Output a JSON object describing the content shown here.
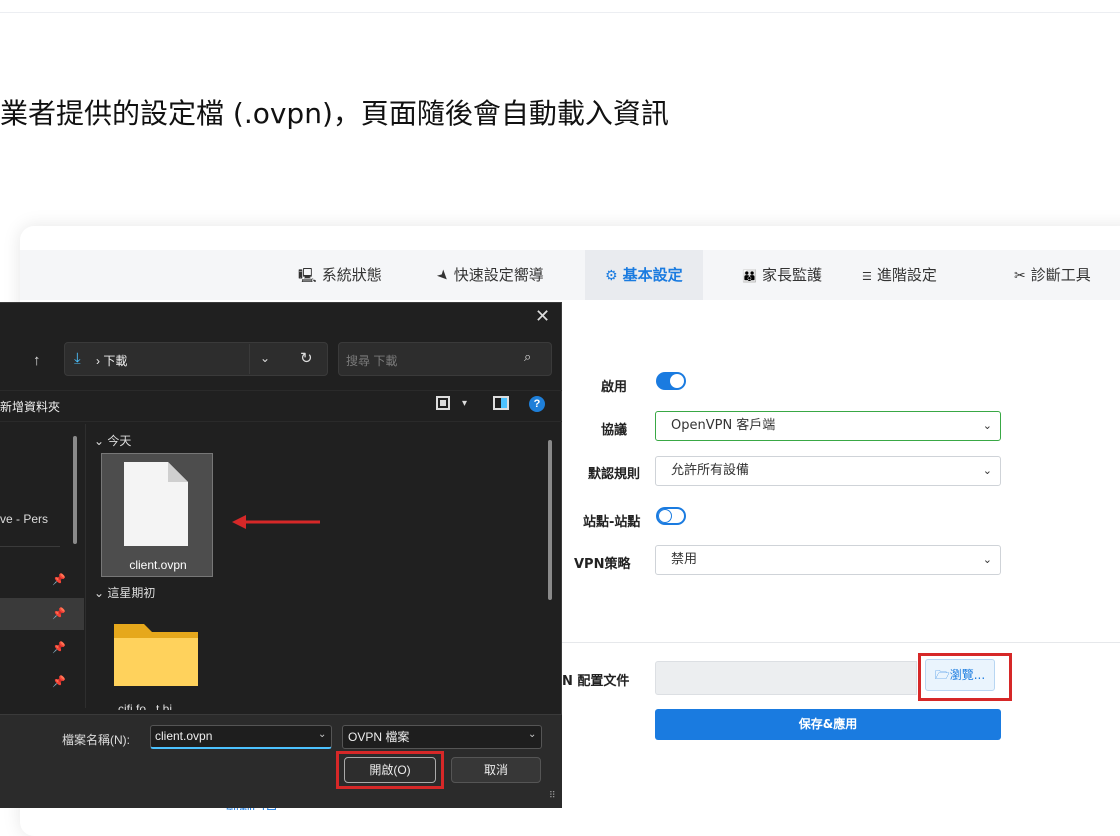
{
  "instruction": "業者提供的設定檔 (.ovpn)，頁面隨後會自動載入資訊",
  "nav": {
    "items": [
      {
        "icon": "desktop-icon",
        "glyph": "🖳",
        "label": "系統狀態"
      },
      {
        "icon": "rocket-icon",
        "glyph": "🚀",
        "label": "快速設定嚮導"
      },
      {
        "icon": "gear-icon",
        "glyph": "⚙",
        "label": "基本設定"
      },
      {
        "icon": "family-icon",
        "glyph": "👪",
        "label": "家長監護"
      },
      {
        "icon": "sliders-icon",
        "glyph": "☰",
        "label": "進階設定"
      },
      {
        "icon": "tools-icon",
        "glyph": "🛠",
        "label": "診斷工具"
      }
    ],
    "active": "基本設定",
    "accent": "#1a7be0"
  },
  "form": {
    "enable_label": "啟用",
    "enable_on": true,
    "protocol_label": "協議",
    "protocol_value": "OpenVPN 客戶端",
    "default_rule_label": "默認規則",
    "default_rule_value": "允許所有設備",
    "site_to_site_label": "站點-站點",
    "site_to_site_on": false,
    "vpn_policy_label": "VPN策略",
    "vpn_policy_value": "禁用",
    "config_file_label": "N 配置文件",
    "browse_label": "瀏覽...",
    "save_label": "保存&應用"
  },
  "bottom_link": "強制門戶",
  "dialog": {
    "breadcrumb": "下載",
    "search_placeholder": "搜尋 下載",
    "new_folder": "新增資料夾",
    "nav_partial_text": "ve - Pers",
    "group_today": "今天",
    "group_week": "這星期初",
    "file_name": "client.ovpn",
    "cut_text": "cifi fo...t bi...",
    "filename_label": "檔案名稱(N):",
    "filename_value": "client.ovpn",
    "filetype_value": "OVPN 檔案",
    "open_label": "開啟(O)",
    "cancel_label": "取消"
  },
  "colors": {
    "highlight_red": "#d62828",
    "primary_blue": "#1a7be0",
    "dialog_bg": "#202020"
  }
}
